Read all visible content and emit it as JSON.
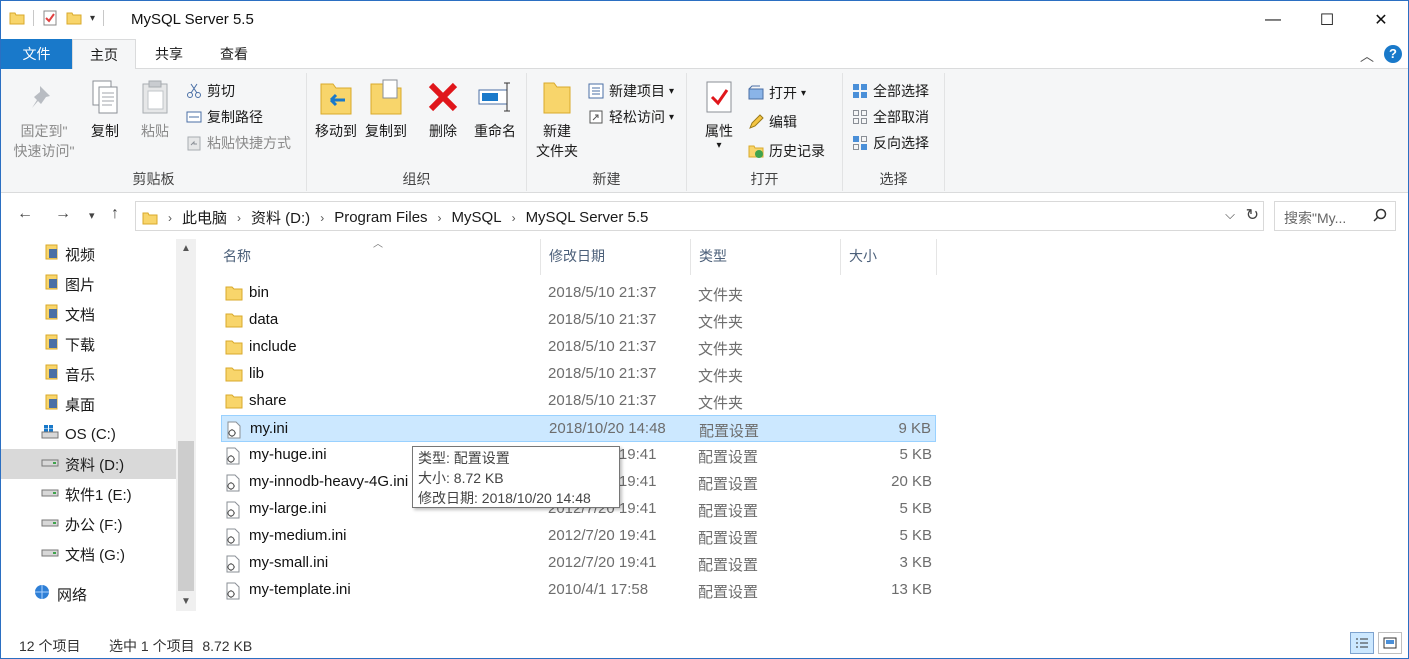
{
  "window": {
    "title": "MySQL Server 5.5",
    "minimize": "—",
    "maximize": "☐",
    "close": "✕"
  },
  "tabs": {
    "file": "文件",
    "home": "主页",
    "share": "共享",
    "view": "查看"
  },
  "ribbon": {
    "clipboard": {
      "label": "剪贴板",
      "pin_line1": "固定到\"",
      "pin_line2": "快速访问\"",
      "copy": "复制",
      "paste": "粘贴",
      "cut": "剪切",
      "copy_path": "复制路径",
      "paste_shortcut": "粘贴快捷方式"
    },
    "organize": {
      "label": "组织",
      "move_to": "移动到",
      "copy_to": "复制到",
      "delete": "删除",
      "rename": "重命名"
    },
    "new": {
      "label": "新建",
      "new_folder_line1": "新建",
      "new_folder_line2": "文件夹",
      "new_item": "新建项目",
      "easy_access": "轻松访问"
    },
    "open": {
      "label": "打开",
      "properties": "属性",
      "open": "打开",
      "edit": "编辑",
      "history": "历史记录"
    },
    "select": {
      "label": "选择",
      "select_all": "全部选择",
      "select_none": "全部取消",
      "invert": "反向选择"
    }
  },
  "address": {
    "crumbs": [
      "此电脑",
      "资料 (D:)",
      "Program Files",
      "MySQL",
      "MySQL Server 5.5"
    ],
    "search_placeholder": "搜索\"My..."
  },
  "nav": {
    "items": [
      {
        "label": "视频",
        "icon": "video-folder-icon"
      },
      {
        "label": "图片",
        "icon": "pictures-folder-icon"
      },
      {
        "label": "文档",
        "icon": "documents-folder-icon"
      },
      {
        "label": "下载",
        "icon": "downloads-folder-icon"
      },
      {
        "label": "音乐",
        "icon": "music-folder-icon"
      },
      {
        "label": "桌面",
        "icon": "desktop-folder-icon"
      },
      {
        "label": "OS (C:)",
        "icon": "windows-drive-icon"
      },
      {
        "label": "资料 (D:)",
        "icon": "drive-icon"
      },
      {
        "label": "软件1 (E:)",
        "icon": "drive-icon"
      },
      {
        "label": "办公 (F:)",
        "icon": "drive-icon"
      },
      {
        "label": "文档 (G:)",
        "icon": "drive-icon"
      },
      {
        "label": "网络",
        "icon": "network-icon"
      }
    ]
  },
  "columns": {
    "name": "名称",
    "date": "修改日期",
    "type": "类型",
    "size": "大小"
  },
  "files": [
    {
      "name": "bin",
      "date": "2018/5/10 21:37",
      "type": "文件夹",
      "size": "",
      "kind": "folder"
    },
    {
      "name": "data",
      "date": "2018/5/10 21:37",
      "type": "文件夹",
      "size": "",
      "kind": "folder"
    },
    {
      "name": "include",
      "date": "2018/5/10 21:37",
      "type": "文件夹",
      "size": "",
      "kind": "folder"
    },
    {
      "name": "lib",
      "date": "2018/5/10 21:37",
      "type": "文件夹",
      "size": "",
      "kind": "folder"
    },
    {
      "name": "share",
      "date": "2018/5/10 21:37",
      "type": "文件夹",
      "size": "",
      "kind": "folder"
    },
    {
      "name": "my.ini",
      "date": "2018/10/20 14:48",
      "type": "配置设置",
      "size": "9 KB",
      "kind": "ini",
      "selected": true
    },
    {
      "name": "my-huge.ini",
      "date": "2012/7/20 19:41",
      "type": "配置设置",
      "size": "5 KB",
      "kind": "ini"
    },
    {
      "name": "my-innodb-heavy-4G.ini",
      "date": "2012/7/20 19:41",
      "type": "配置设置",
      "size": "20 KB",
      "kind": "ini"
    },
    {
      "name": "my-large.ini",
      "date": "2012/7/20 19:41",
      "type": "配置设置",
      "size": "5 KB",
      "kind": "ini"
    },
    {
      "name": "my-medium.ini",
      "date": "2012/7/20 19:41",
      "type": "配置设置",
      "size": "5 KB",
      "kind": "ini"
    },
    {
      "name": "my-small.ini",
      "date": "2012/7/20 19:41",
      "type": "配置设置",
      "size": "3 KB",
      "kind": "ini"
    },
    {
      "name": "my-template.ini",
      "date": "2010/4/1 17:58",
      "type": "配置设置",
      "size": "13 KB",
      "kind": "ini"
    }
  ],
  "tooltip": {
    "line1": "类型: 配置设置",
    "line2": "大小: 8.72 KB",
    "line3": "修改日期: 2018/10/20 14:48"
  },
  "status": {
    "count": "12 个项目",
    "selection": "选中 1 个项目  8.72 KB"
  },
  "colors": {
    "accent": "#1979ca",
    "selection": "#cce8ff",
    "folder": "#f8d56b"
  }
}
